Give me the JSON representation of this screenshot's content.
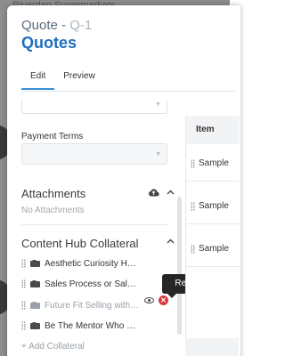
{
  "backdrop": {
    "title": "Riverdan Supermarkets"
  },
  "header": {
    "subtitle_prefix": "Quote - ",
    "subtitle_id": "Q-1",
    "title": "Quotes"
  },
  "tabs": [
    {
      "label": "Edit",
      "active": true
    },
    {
      "label": "Preview",
      "active": false
    }
  ],
  "form": {
    "payment_terms_label": "Payment Terms"
  },
  "attachments": {
    "title": "Attachments",
    "empty_text": "No Attachments"
  },
  "collateral": {
    "title": "Content Hub Collateral",
    "items": [
      {
        "label": "Aesthetic Curiosity Help..."
      },
      {
        "label": "Sales Process or Sales ..."
      },
      {
        "label": "Future Fit Selling with Ja..."
      },
      {
        "label": "Be The Mentor Who Ma..."
      }
    ],
    "add_label": "+ Add Collateral"
  },
  "tooltip": {
    "text": "Remove"
  },
  "table": {
    "header": "Item",
    "rows": [
      {
        "label": "Sample"
      },
      {
        "label": "Sample"
      },
      {
        "label": "Sample"
      }
    ]
  },
  "colors": {
    "accent": "#1f6fc0",
    "danger": "#d93a3a",
    "tab_underline": "#3a8fd8"
  }
}
